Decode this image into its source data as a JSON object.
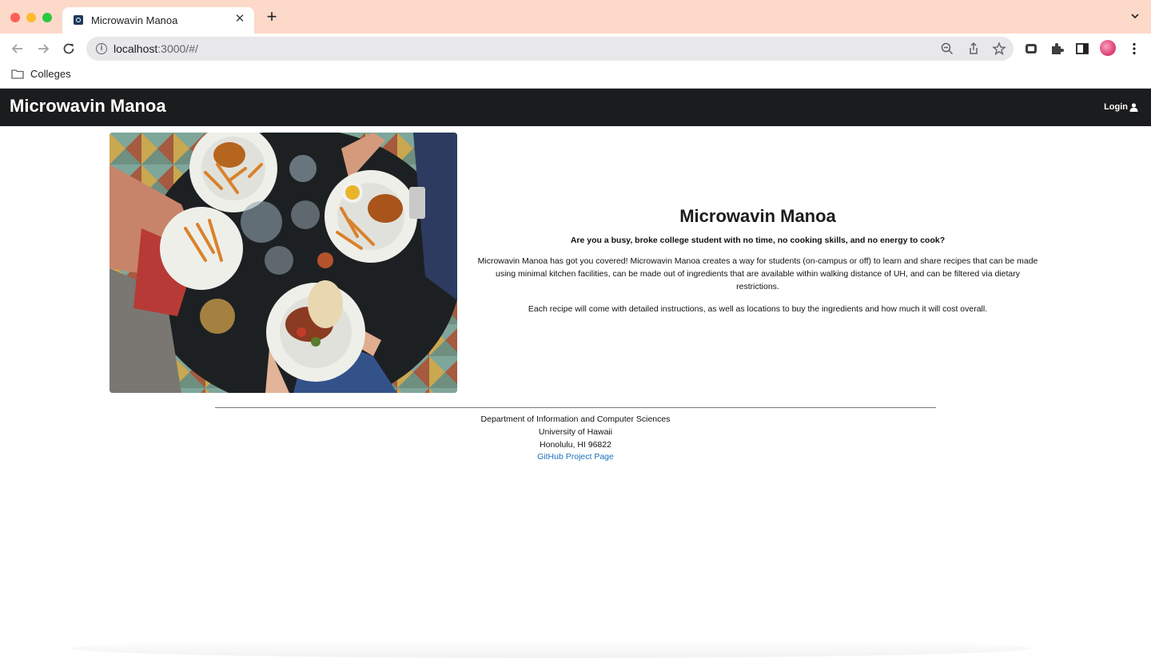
{
  "browser": {
    "tab_title": "Microwavin Manoa",
    "tab_close": "✕",
    "new_tab": "+",
    "url_host": "localhost",
    "url_rest": ":3000/#/",
    "bookmarks": [
      {
        "label": "Colleges",
        "icon": "folder-icon"
      }
    ]
  },
  "navbar": {
    "brand": "Microwavin Manoa",
    "login_label": "Login",
    "login_icon": "user-icon"
  },
  "hero": {
    "image_icon": "food-table-photo"
  },
  "landing": {
    "title": "Microwavin Manoa",
    "subtitle": "Are you a busy, broke college student with no time, no cooking skills, and no energy to cook?",
    "paragraph1": "Microwavin Manoa has got you covered! Microwavin Manoa creates a way for students (on-campus or off) to learn and share recipes that can be made using minimal kitchen facilities, can be made out of ingredients that are available within walking distance of UH, and can be filtered via dietary restrictions.",
    "paragraph2": "Each recipe will come with detailed instructions, as well as locations to buy the ingredients and how much it will cost overall."
  },
  "footer": {
    "line1": "Department of Information and Computer Sciences",
    "line2": "University of Hawaii",
    "line3": "Honolulu, HI 96822",
    "link_label": "GitHub Project Page"
  },
  "colors": {
    "tabstrip": "#fcd9c8",
    "navbar": "#1b1c1d",
    "link": "#1e70bf"
  }
}
